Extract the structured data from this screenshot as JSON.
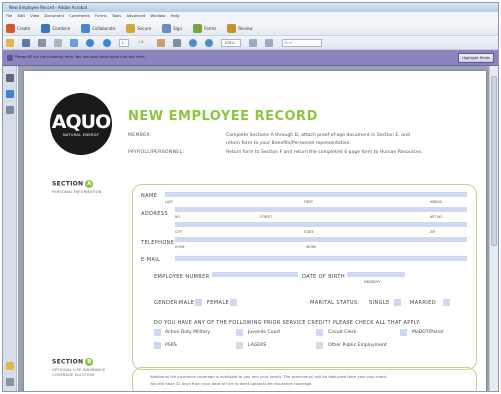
{
  "window": {
    "title": "New Employee Record - Adobe Acrobat"
  },
  "menu": [
    "File",
    "Edit",
    "View",
    "Document",
    "Comments",
    "Forms",
    "Tools",
    "Advanced",
    "Window",
    "Help"
  ],
  "toolbar": [
    {
      "label": "Create",
      "color": "#d45a2a"
    },
    {
      "label": "Combine",
      "color": "#3d74b8"
    },
    {
      "label": "Collaborate",
      "color": "#4a86c9"
    },
    {
      "label": "Secure",
      "color": "#d3a43a"
    },
    {
      "label": "Sign",
      "color": "#6c8cbf"
    },
    {
      "label": "Forms",
      "color": "#7aa33d"
    },
    {
      "label": "Review",
      "color": "#c8922b"
    }
  ],
  "navbar": {
    "page_number": "1",
    "page_total": "/ 4",
    "zoom": "100%",
    "search_placeholder": "Find"
  },
  "form_bar": {
    "message": "Please fill out the following form. You can save data typed into this form.",
    "button_label": "Highlight Fields",
    "color": "#8b84bf"
  },
  "document": {
    "logo": {
      "word": "AQUO",
      "sub": "NATURAL ENERGY"
    },
    "title": "NEW EMPLOYEE RECORD",
    "member_label": "MEMBER:",
    "member_text_1": "Complete Sections A through D, attach proof-of-age document in Section E, and",
    "member_text_2": "return form to your Benefits/Personnel representative.",
    "payroll_label": "PAYROLL/PERSONNEL:",
    "payroll_text": "Return form to Section F and return the completed 4-page form to Human Resources.",
    "section_a": {
      "title": "SECTION",
      "num": "A",
      "sub": "PERSONAL INFORMATION"
    },
    "section_b": {
      "title": "SECTION",
      "num": "B",
      "sub_1": "OPTIONAL LIFE INSURANCE",
      "sub_2": "COVERAGE ELECTION"
    },
    "name_label": "NAME",
    "name_caps": [
      "LAST",
      "FIRST",
      "MIDDLE"
    ],
    "address_label": "ADDRESS",
    "address_caps": [
      "NO.",
      "STREET",
      "APT NO."
    ],
    "address_caps_2": [
      "CITY",
      "STATE",
      "ZIP"
    ],
    "telephone_label": "TELEPHONE",
    "telephone_caps": [
      "HOME",
      "WORK"
    ],
    "email_label": "E-MAIL",
    "employee_number_label": "EMPLOYEE NUMBER",
    "dob_label": "DATE OF BIRTH",
    "dob_cap": "MM/DD/YY",
    "gender_label": "GENDER:",
    "male_label": "MALE",
    "female_label": "FEMALE",
    "marital_label": "MARITAL STATUS:",
    "single_label": "SINGLE",
    "married_label": "MARRIED",
    "service_question": "DO YOU HAVE ANY OF THE FOLLOWING PRIOR SERVICE CREDIT? PLEASE CHECK ALL THAT APPLY:",
    "service_options": [
      "Active Duty Military",
      "Juvenile Court",
      "Circuit Clerk",
      "MoDOT/Patrol",
      "PSRS",
      "LAGERS",
      "Other Public Employment"
    ],
    "section_b_text_1": "Additional life insurance coverage is available to you and your family. The premium(s) will be deducted from your pay check.",
    "section_b_text_2": "You will have 31 days from your date of hire to elect optional life insurance coverage."
  }
}
